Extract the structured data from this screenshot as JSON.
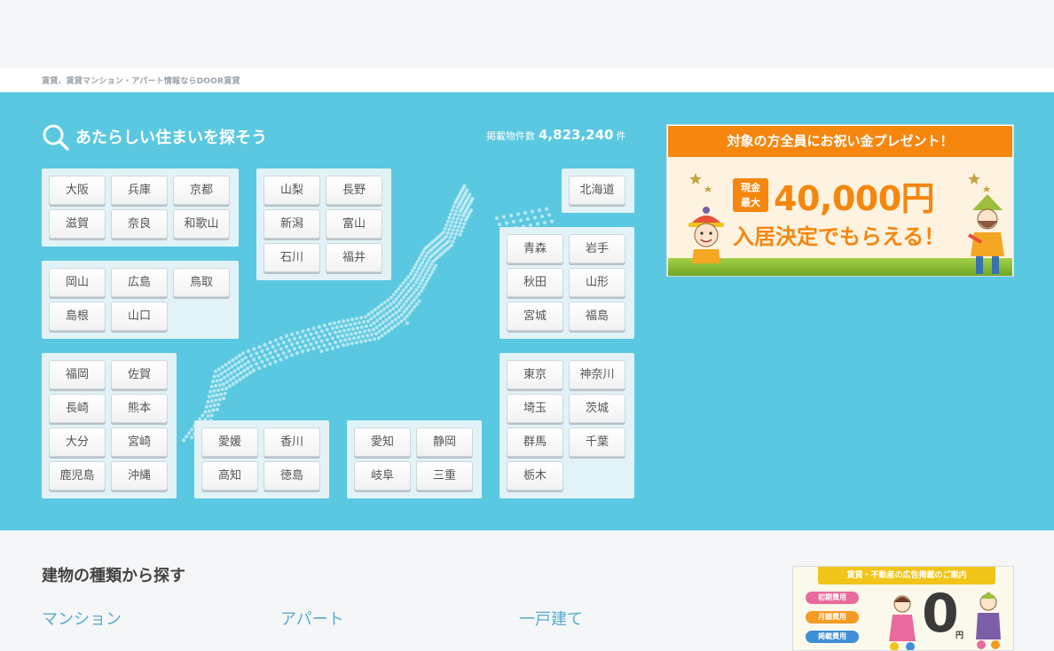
{
  "breadcrumb": "賃貸、賃貸マンション・アパート情報ならDOOR賃貸",
  "hero": {
    "title": "あたらしい住まいを探そう",
    "count_label": "掲載物件数",
    "count": "4,823,240",
    "count_unit": "件"
  },
  "regions": {
    "kinki": [
      "大阪",
      "兵庫",
      "京都",
      "滋賀",
      "奈良",
      "和歌山"
    ],
    "chugoku": [
      "岡山",
      "広島",
      "鳥取",
      "島根",
      "山口"
    ],
    "kyushu": [
      "福岡",
      "佐賀",
      "長崎",
      "熊本",
      "大分",
      "宮崎",
      "鹿児島",
      "沖縄"
    ],
    "koshinetsu": [
      "山梨",
      "長野",
      "新潟",
      "富山",
      "石川",
      "福井"
    ],
    "shikoku": [
      "愛媛",
      "香川",
      "高知",
      "徳島"
    ],
    "tokai": [
      "愛知",
      "静岡",
      "岐阜",
      "三重"
    ],
    "hokkaido": [
      "北海道"
    ],
    "tohoku": [
      "青森",
      "岩手",
      "秋田",
      "山形",
      "宮城",
      "福島"
    ],
    "kanto": [
      "東京",
      "神奈川",
      "埼玉",
      "茨城",
      "群馬",
      "千葉",
      "栃木"
    ]
  },
  "banner": {
    "header": "対象の方全員にお祝い金プレゼント！",
    "badge_line1": "現金",
    "badge_line2": "最大",
    "amount": "40,000円",
    "subtitle": "入居決定でもらえる！"
  },
  "types": {
    "heading": "建物の種類から探す",
    "items": [
      "マンション",
      "アパート",
      "一戸建て"
    ]
  },
  "ad2": {
    "header": "賃貸・不動産の広告掲載のご案内",
    "pills": [
      {
        "label": "初期費用",
        "color": "#e96a9c"
      },
      {
        "label": "月額費用",
        "color": "#f59a23"
      },
      {
        "label": "掲載費用",
        "color": "#3f8fd6"
      }
    ],
    "zero": "0",
    "yen": "円"
  },
  "colors": {
    "hero_bg": "#5ac8e1",
    "accent_orange": "#f5860e",
    "link_blue": "#5aaccf"
  }
}
